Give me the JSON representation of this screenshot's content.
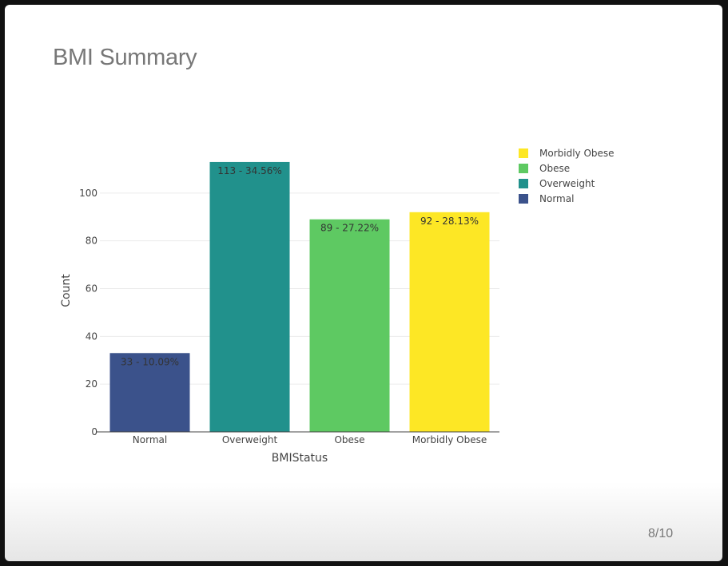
{
  "slide": {
    "title": "BMI Summary",
    "page_number": "8/10"
  },
  "chart_data": {
    "type": "bar",
    "categories": [
      "Normal",
      "Overweight",
      "Obese",
      "Morbidly Obese"
    ],
    "values": [
      33,
      113,
      89,
      92
    ],
    "bar_labels": [
      "33 - 10.09%",
      "113 - 34.56%",
      "89 - 27.22%",
      "92 - 28.13%"
    ],
    "colors": [
      "#3b528b",
      "#21918c",
      "#5ec962",
      "#fde725"
    ],
    "xlabel": "BMIStatus",
    "ylabel": "Count",
    "ylim": [
      0,
      120
    ],
    "yticks": [
      0,
      20,
      40,
      60,
      80,
      100
    ],
    "grid": true,
    "legend": {
      "placement": "right",
      "items": [
        {
          "label": "Morbidly Obese",
          "color": "#fde725"
        },
        {
          "label": "Obese",
          "color": "#5ec962"
        },
        {
          "label": "Overweight",
          "color": "#21918c"
        },
        {
          "label": "Normal",
          "color": "#3b528b"
        }
      ]
    }
  }
}
